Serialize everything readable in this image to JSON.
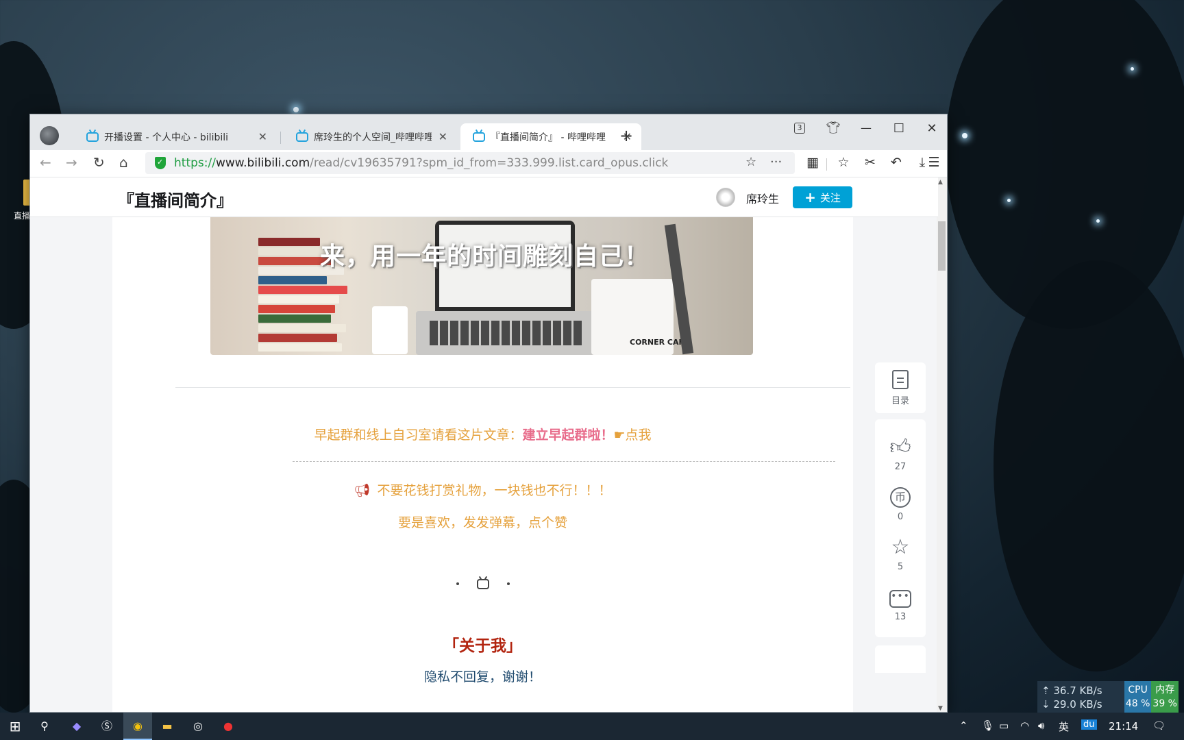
{
  "desktop": {
    "icon_label": "直播"
  },
  "browser": {
    "tab_count_badge": "3",
    "tabs": [
      {
        "title": "开播设置 - 个人中心 - bilibili"
      },
      {
        "title": "席玲生的个人空间_哔哩哔哩_b"
      },
      {
        "title": "『直播间简介』 - 哔哩哔哩"
      }
    ],
    "url": {
      "scheme": "https://",
      "domain": "www.bilibili.com",
      "path": "/read/cv19635791?spm_id_from=333.999.list.card_opus.click"
    }
  },
  "page": {
    "header": {
      "title": "『直播间简介』",
      "author": "席玲生",
      "follow_label": "关注"
    },
    "banner": {
      "slogan": "来，用一年的时间雕刻自己！",
      "cafe_text": "CORNER CAFE"
    },
    "content": {
      "line1_prefix": "早起群和线上自习室请看这片文章：",
      "line1_link": "建立早起群啦！",
      "line1_suffix": "点我",
      "line2": "不要花钱打赏礼物，一块钱也不行！！！",
      "line3": "要是喜欢，发发弹幕，点个赞",
      "about_heading": "「关于我」",
      "privacy_note": "隐私不回复，谢谢！"
    },
    "sidebar": {
      "toc_label": "目录",
      "likes": "27",
      "coins": "0",
      "favorites": "5",
      "comments": "13"
    }
  },
  "system": {
    "upload_speed": "36.7 KB/s",
    "download_speed": "29.0 KB/s",
    "cpu_label": "CPU",
    "cpu_value": "48 %",
    "mem_label": "内存",
    "mem_value": "39 %",
    "ime": "英",
    "time": "21:14"
  },
  "colors": {
    "bilibili_blue": "#00a1d6",
    "text_orange": "#e5a13c",
    "link_pink": "#e86c8b",
    "heading_red": "#b2240f"
  }
}
